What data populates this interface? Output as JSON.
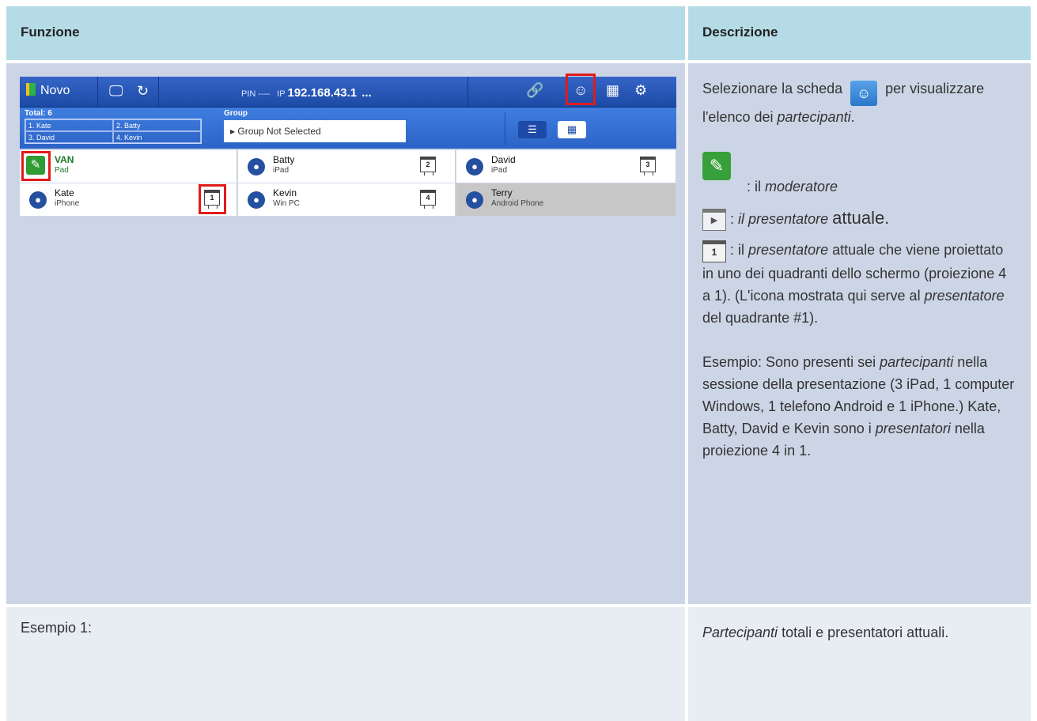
{
  "table": {
    "header_left": "Funzione",
    "header_right": "Descrizione"
  },
  "screenshot": {
    "brand": "Novo",
    "pin_label": "PIN",
    "pin_value": "----",
    "ip_label": "IP",
    "ip_value": "192.168.43.1",
    "ellipsis": "...",
    "total_label": "Total: 6",
    "total_grid": [
      "1. Kate",
      "2. Batty",
      "3. David",
      "4. Kevin"
    ],
    "group_label": "Group",
    "group_value": "Group Not Selected",
    "participants": [
      {
        "name": "VAN",
        "device": "Pad",
        "role": "moderator",
        "quadrant": ""
      },
      {
        "name": "Batty",
        "device": "iPad",
        "role": "presenter",
        "quadrant": "2"
      },
      {
        "name": "David",
        "device": "iPad",
        "role": "presenter",
        "quadrant": "3"
      },
      {
        "name": "Kate",
        "device": "iPhone",
        "role": "presenter",
        "quadrant": "1"
      },
      {
        "name": "Kevin",
        "device": "Win PC",
        "role": "presenter",
        "quadrant": "4"
      },
      {
        "name": "Terry",
        "device": "Android Phone",
        "role": "participant",
        "quadrant": ""
      }
    ],
    "icons": {
      "screen": "display-icon",
      "refresh": "refresh-icon",
      "link": "link-icon",
      "participants": "participants-icon",
      "grid": "grid-icon",
      "settings": "gear-icon",
      "list_view": "list-view-icon",
      "grid_view": "grid-view-icon"
    }
  },
  "description": {
    "p1_a": "Selezionare la scheda",
    "p1_b": "per visualizzare l'elenco dei",
    "p1_em": "partecipanti",
    "p1_end": ".",
    "mod_pre": ": il",
    "mod_em": "moderatore",
    "pres_pre": ":",
    "pres_em": "il presentatore",
    "pres_post": "attuale.",
    "quad_pre": ": il",
    "quad_em": "presentatore",
    "quad_post": "attuale che viene proiettato in uno dei quadranti dello schermo (proiezione 4 a 1). (L'icona mostrata qui serve al",
    "quad_em2": "presentatore",
    "quad_post2": "del quadrante #1).",
    "ex_a": "Esempio: Sono presenti sei",
    "ex_em": "partecipanti",
    "ex_b": "nella sessione della presentazione (3 iPad, 1 computer Windows, 1 telefono Android e 1 iPhone.) Kate, Batty, David e Kevin sono i",
    "ex_em2": "presentatori",
    "ex_c": "nella proiezione 4 in 1.",
    "quad_icon_number": "1"
  },
  "row2": {
    "left": "Esempio 1:",
    "right_em": "Partecipanti",
    "right_rest": "totali e presentatori attuali."
  },
  "colors": {
    "header_bg": "#b5dce6",
    "row_bg": "#ccd5e6",
    "row2_bg": "#e8ecf3",
    "highlight": "#e11b1b",
    "topbar": "#1c4aa6"
  }
}
